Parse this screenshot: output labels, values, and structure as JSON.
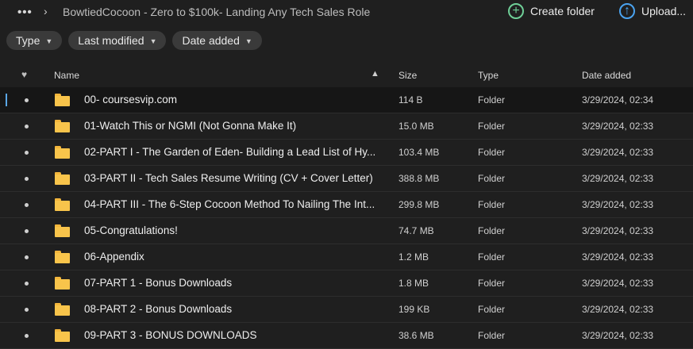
{
  "topbar": {
    "more_label": "•••",
    "separator": "›",
    "breadcrumb": "BowtiedCocoon - Zero to $100k- Landing Any Tech Sales Role",
    "create_folder_label": "Create folder",
    "upload_label": "Upload..."
  },
  "filters": [
    {
      "label": "Type"
    },
    {
      "label": "Last modified"
    },
    {
      "label": "Date added"
    }
  ],
  "table": {
    "headers": {
      "name": "Name",
      "size": "Size",
      "type": "Type",
      "date_added": "Date added"
    },
    "rows": [
      {
        "name": "00- coursesvip.com",
        "size": "114 B",
        "type": "Folder",
        "date_added": "3/29/2024, 02:34",
        "selected": true
      },
      {
        "name": "01-Watch This or NGMI (Not Gonna Make It)",
        "size": "15.0 MB",
        "type": "Folder",
        "date_added": "3/29/2024, 02:33"
      },
      {
        "name": "02-PART I - The Garden of Eden- Building a Lead List of Hy...",
        "size": "103.4 MB",
        "type": "Folder",
        "date_added": "3/29/2024, 02:33"
      },
      {
        "name": "03-PART II - Tech Sales Resume Writing (CV + Cover Letter)",
        "size": "388.8 MB",
        "type": "Folder",
        "date_added": "3/29/2024, 02:33"
      },
      {
        "name": "04-PART III - The 6-Step Cocoon Method To Nailing The Int...",
        "size": "299.8 MB",
        "type": "Folder",
        "date_added": "3/29/2024, 02:33"
      },
      {
        "name": "05-Congratulations!",
        "size": "74.7 MB",
        "type": "Folder",
        "date_added": "3/29/2024, 02:33"
      },
      {
        "name": "06-Appendix",
        "size": "1.2 MB",
        "type": "Folder",
        "date_added": "3/29/2024, 02:33"
      },
      {
        "name": "07-PART 1 - Bonus Downloads",
        "size": "1.8 MB",
        "type": "Folder",
        "date_added": "3/29/2024, 02:33"
      },
      {
        "name": "08-PART 2 - Bonus Downloads",
        "size": "199 KB",
        "type": "Folder",
        "date_added": "3/29/2024, 02:33"
      },
      {
        "name": "09-PART 3 - BONUS DOWNLOADS",
        "size": "38.6 MB",
        "type": "Folder",
        "date_added": "3/29/2024, 02:33"
      }
    ]
  },
  "colors": {
    "background": "#1f1f1f",
    "folder": "#f8c44b",
    "create_icon": "#6fcf97",
    "upload_icon": "#4aa3f0",
    "selection_marker": "#5aa7e6"
  }
}
